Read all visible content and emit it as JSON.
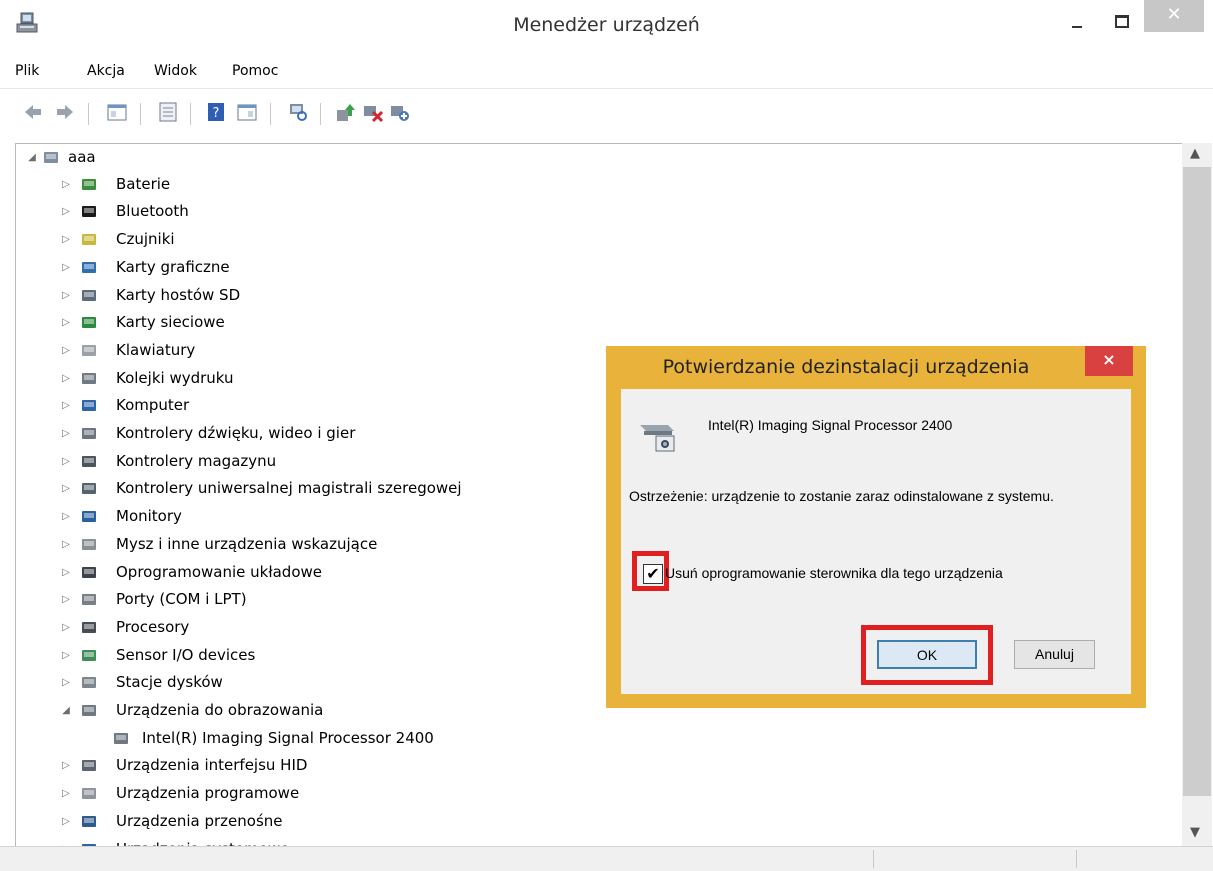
{
  "window": {
    "title": "Menedżer urządzeń",
    "close_glyph": "✕"
  },
  "menu": [
    "Plik",
    "Akcja",
    "Widok",
    "Pomoc"
  ],
  "toolbar": [
    "back-icon",
    "forward-icon",
    "properties-view-icon",
    "device-list-icon",
    "help-icon",
    "view-pane-icon",
    "scan-hardware-icon",
    "update-driver-icon",
    "uninstall-device-icon",
    "enable-device-icon"
  ],
  "tree": {
    "root": "aaa",
    "items": [
      {
        "label": "Baterie"
      },
      {
        "label": "Bluetooth"
      },
      {
        "label": "Czujniki"
      },
      {
        "label": "Karty graficzne"
      },
      {
        "label": "Karty hostów SD"
      },
      {
        "label": "Karty sieciowe"
      },
      {
        "label": "Klawiatury"
      },
      {
        "label": "Kolejki wydruku"
      },
      {
        "label": "Komputer"
      },
      {
        "label": "Kontrolery dźwięku, wideo i gier"
      },
      {
        "label": "Kontrolery magazynu"
      },
      {
        "label": "Kontrolery uniwersalnej magistrali szeregowej"
      },
      {
        "label": "Monitory"
      },
      {
        "label": "Mysz i inne urządzenia wskazujące"
      },
      {
        "label": "Oprogramowanie układowe"
      },
      {
        "label": "Porty (COM i LPT)"
      },
      {
        "label": "Procesory"
      },
      {
        "label": "Sensor I/O devices"
      },
      {
        "label": "Stacje dysków"
      },
      {
        "label": "Urządzenia do obrazowania"
      },
      {
        "label": "Intel(R) Imaging Signal Processor 2400"
      },
      {
        "label": "Urządzenia interfejsu HID"
      },
      {
        "label": "Urządzenia programowe"
      },
      {
        "label": "Urządzenia przenośne"
      },
      {
        "label": "Urządzenia systemowe"
      }
    ]
  },
  "dialog": {
    "title": "Potwierdzanie dezinstalacji urządzenia",
    "close_glyph": "×",
    "device_name": "Intel(R) Imaging Signal Processor 2400",
    "warning": "Ostrzeżenie: urządzenie to zostanie zaraz odinstalowane z systemu.",
    "checkbox_label": "Usuń oprogramowanie sterownika dla tego urządzenia",
    "checkbox_checked": true,
    "check_glyph": "✔",
    "ok_label": "OK",
    "cancel_label": "Anuluj"
  },
  "colors": {
    "dialog_frame": "#e9b33b",
    "highlight": "#e02020",
    "dialog_close": "#d94040"
  }
}
